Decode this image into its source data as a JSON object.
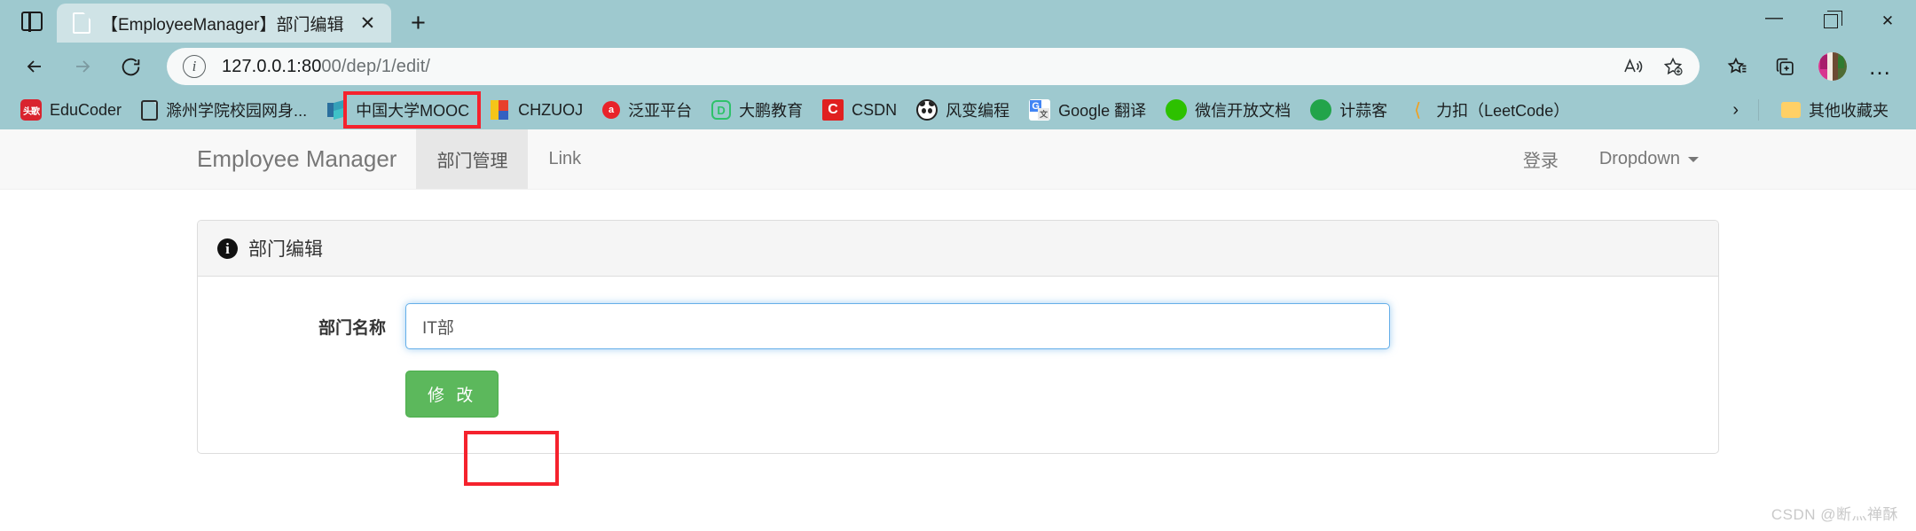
{
  "browser": {
    "tab": {
      "title": "【EmployeeManager】部门编辑",
      "close_label": "✕",
      "favicon_name": "page-favicon"
    },
    "new_tab_label": "+",
    "tab_actions_name": "tab-actions",
    "window_controls": {
      "minimize": "—",
      "maximize": "maximize",
      "close": "✕"
    },
    "nav": {
      "back_label": "back",
      "forward_label": "forward",
      "reload_label": "reload"
    },
    "omnibox": {
      "url_host": "127.0.0.1:80",
      "url_rest": "00/dep/1/edit/",
      "url_full": "127.0.0.1:8000/dep/1/edit/",
      "site_info_label": "i",
      "read_aloud_label": "read-aloud",
      "add_favorite_label": "add-favorite"
    },
    "toolbar_right": {
      "favorites_label": "favorites",
      "collections_label": "collections",
      "profile_label": "profile",
      "settings_label": "…"
    },
    "bookmarks": [
      {
        "label": "EduCoder",
        "icon": "educoder-icon",
        "icon_text": "头歌"
      },
      {
        "label": "滁州学院校园网身...",
        "icon": "document-icon",
        "icon_text": ""
      },
      {
        "label": "中国大学MOOC",
        "icon": "mooc-icon",
        "icon_text": ""
      },
      {
        "label": "CHZUOJ",
        "icon": "chzuoj-icon",
        "icon_text": ""
      },
      {
        "label": "泛亚平台",
        "icon": "fanya-icon",
        "icon_text": "a"
      },
      {
        "label": "大鹏教育",
        "icon": "dapeng-icon",
        "icon_text": "D"
      },
      {
        "label": "CSDN",
        "icon": "csdn-icon",
        "icon_text": "C"
      },
      {
        "label": "风变编程",
        "icon": "fengbian-icon",
        "icon_text": ""
      },
      {
        "label": "Google 翻译",
        "icon": "google-translate-icon",
        "icon_text": ""
      },
      {
        "label": "微信开放文档",
        "icon": "wechat-icon",
        "icon_text": ""
      },
      {
        "label": "计蒜客",
        "icon": "jisuanke-icon",
        "icon_text": ""
      },
      {
        "label": "力扣（LeetCode）",
        "icon": "leetcode-icon",
        "icon_text": "⟨"
      }
    ],
    "bookmarks_overflow": {
      "chevron": "›",
      "other_folder_label": "其他收藏夹",
      "other_folder_icon": "folder-icon"
    }
  },
  "navbar": {
    "brand": "Employee Manager",
    "links": [
      {
        "label": "部门管理",
        "active": true
      },
      {
        "label": "Link",
        "active": false
      }
    ],
    "right_links": [
      {
        "label": "登录",
        "dropdown": false
      },
      {
        "label": "Dropdown",
        "dropdown": true
      }
    ]
  },
  "card": {
    "header_icon": "info-icon",
    "header_title": "部门编辑",
    "form": {
      "field_label": "部门名称",
      "field_value": "IT部",
      "field_placeholder": "",
      "submit_label": "修 改"
    }
  },
  "annotations": [
    {
      "name": "url-highlight-box",
      "color": "#f5222d"
    },
    {
      "name": "input-highlight-box",
      "color": "#f5222d"
    }
  ],
  "watermark": "CSDN @断灬禅酥",
  "colors": {
    "chrome_bg": "#9ec9cf",
    "tab_bg": "#cfe3e6",
    "omnibox_bg": "#f7f9f9",
    "navbar_bg": "#f8f8f8",
    "navbar_active_bg": "#e7e7e7",
    "card_header_bg": "#f5f5f5",
    "card_border": "#dddddd",
    "input_focus_border": "#66afe9",
    "submit_green": "#5cb85c",
    "annotation_red": "#f5222d",
    "watermark_gray": "#c9c9c9"
  }
}
